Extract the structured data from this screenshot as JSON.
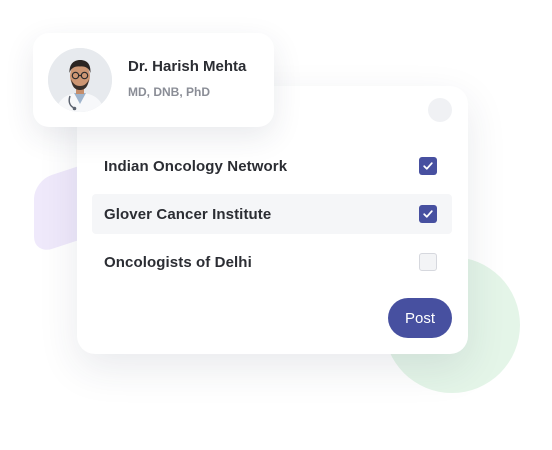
{
  "profile": {
    "name": "Dr. Harish Mehta",
    "credentials": "MD, DNB, PhD"
  },
  "groups": [
    {
      "label": "Indian Oncology Network",
      "checked": true
    },
    {
      "label": "Glover Cancer Institute",
      "checked": true
    },
    {
      "label": "Oncologists of Delhi",
      "checked": false
    }
  ],
  "post_button_label": "Post",
  "colors": {
    "accent": "#4750a0",
    "text": "#2b2d33",
    "muted": "#8a8d96",
    "highlight_row": "#f5f6f8",
    "decor_purple": "#efe9fb",
    "decor_green": "#e4f5e8"
  }
}
